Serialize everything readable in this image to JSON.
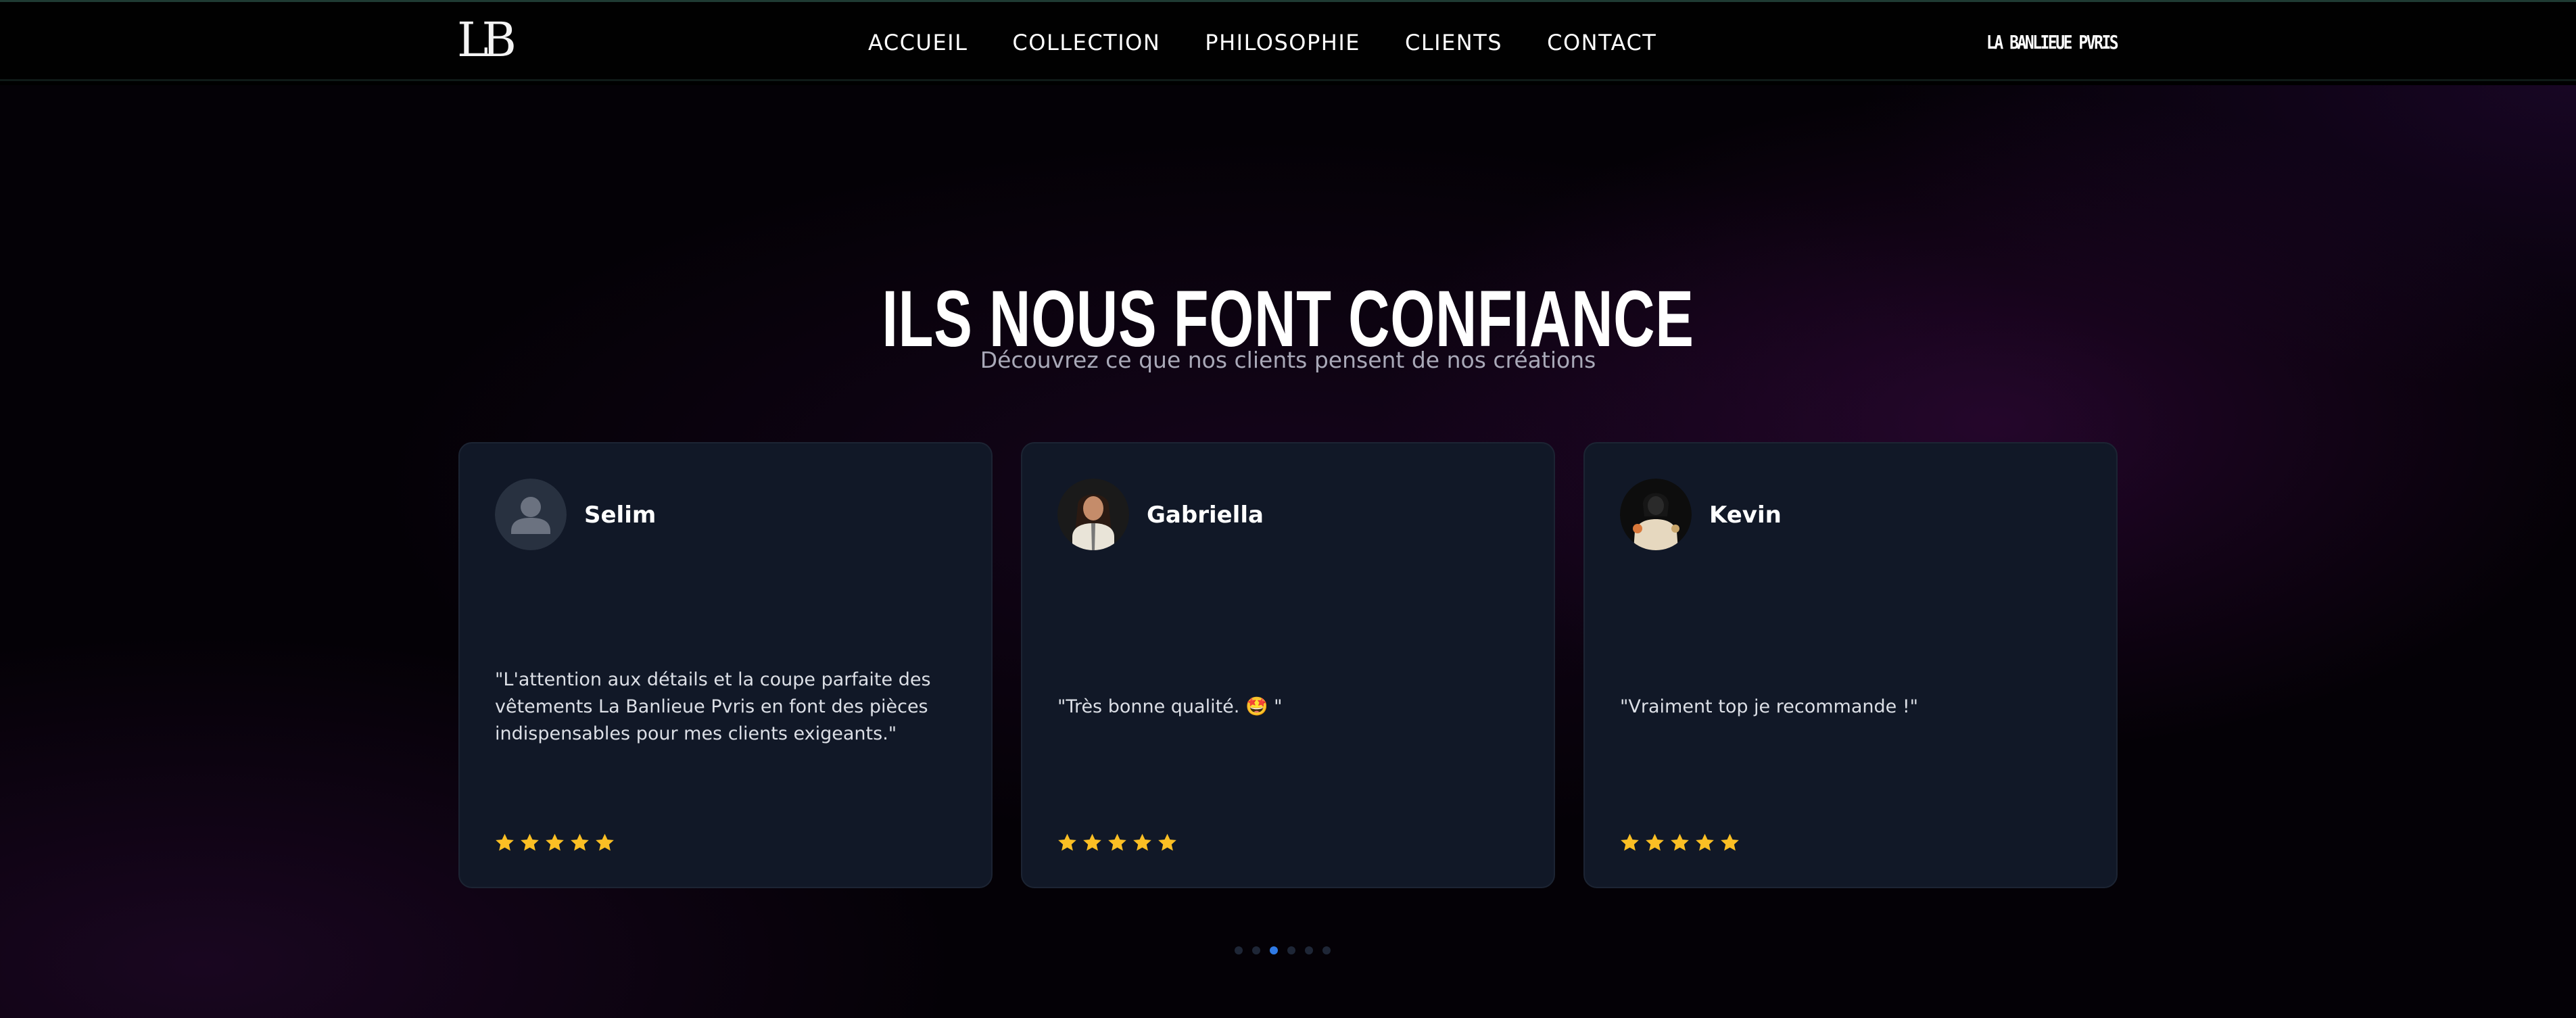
{
  "header": {
    "logo_text": "LB",
    "nav": [
      {
        "label": "ACCUEIL"
      },
      {
        "label": "COLLECTION"
      },
      {
        "label": "PHILOSOPHIE"
      },
      {
        "label": "CLIENTS"
      },
      {
        "label": "CONTACT"
      }
    ],
    "brand": "LA BANLIEUE PVRIS"
  },
  "section": {
    "title": "ILS NOUS FONT CONFIANCE",
    "subtitle": "Découvrez ce que nos clients pensent de nos créations"
  },
  "testimonials": [
    {
      "name": "Selim",
      "avatar": "default-user-icon",
      "quote": "\"L'attention aux détails et la coupe parfaite des vêtements La Banlieue Pvris en font des pièces indispensables pour mes clients exigeants.\"",
      "rating": 5
    },
    {
      "name": "Gabriella",
      "avatar": "user-photo",
      "quote": "\"Très bonne qualité. 🤩 \"",
      "rating": 5
    },
    {
      "name": "Kevin",
      "avatar": "user-photo",
      "quote": "\"Vraiment top je recommande !\"",
      "rating": 5
    }
  ],
  "pagination": {
    "count": 6,
    "active_index": 2
  },
  "colors": {
    "accent": "#2f7ae5",
    "star": "#fbbf24",
    "card_bg": "#111827"
  }
}
